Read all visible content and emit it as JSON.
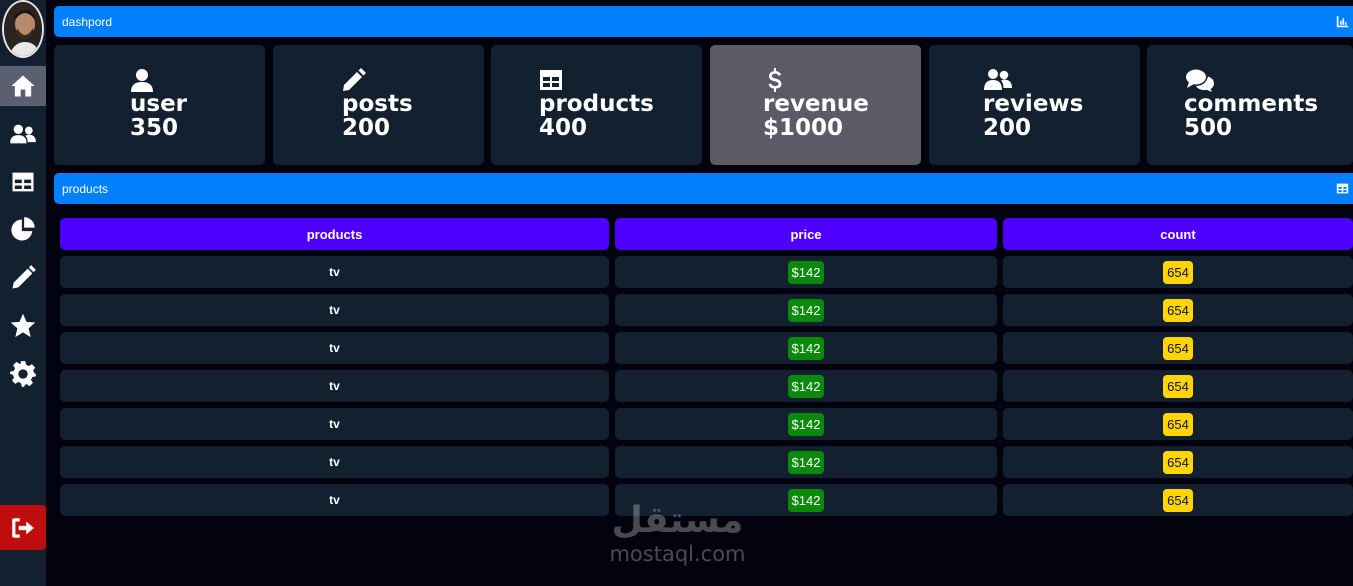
{
  "sidebar": {
    "items": [
      {
        "icon": "home-icon",
        "active": true
      },
      {
        "icon": "users-icon",
        "active": false
      },
      {
        "icon": "table-icon",
        "active": false
      },
      {
        "icon": "pie-chart-icon",
        "active": false
      },
      {
        "icon": "pencil-icon",
        "active": false
      },
      {
        "icon": "star-icon",
        "active": false
      },
      {
        "icon": "gear-icon",
        "active": false
      }
    ],
    "logout_icon": "sign-out-icon"
  },
  "header": {
    "title": "dashpord",
    "icon": "chart-bar-icon"
  },
  "cards": [
    {
      "icon": "user-icon",
      "label": "user",
      "value": "350"
    },
    {
      "icon": "pencil-icon",
      "label": "posts",
      "value": "200"
    },
    {
      "icon": "table-icon",
      "label": "products",
      "value": "400"
    },
    {
      "icon": "dollar-icon",
      "label": "revenue",
      "value": "$1000"
    },
    {
      "icon": "users-icon",
      "label": "reviews",
      "value": "200"
    },
    {
      "icon": "comments-icon",
      "label": "comments",
      "value": "500"
    }
  ],
  "products_section": {
    "title": "products",
    "icon": "table-icon"
  },
  "table": {
    "headers": [
      "products",
      "price",
      "count"
    ],
    "rows": [
      {
        "product": "tv",
        "price": "$142",
        "count": "654"
      },
      {
        "product": "tv",
        "price": "$142",
        "count": "654"
      },
      {
        "product": "tv",
        "price": "$142",
        "count": "654"
      },
      {
        "product": "tv",
        "price": "$142",
        "count": "654"
      },
      {
        "product": "tv",
        "price": "$142",
        "count": "654"
      },
      {
        "product": "tv",
        "price": "$142",
        "count": "654"
      },
      {
        "product": "tv",
        "price": "$142",
        "count": "654"
      }
    ]
  },
  "watermark": {
    "arabic": "مستقل",
    "latin": "mostaql.com"
  },
  "colors": {
    "background": "#02030f",
    "panel": "#132030",
    "accent_blue": "#0080ff",
    "header_purple": "#4d00ff",
    "price_green": "#0a8a0a",
    "count_yellow": "#ffd500",
    "logout_red": "#c00d0d",
    "highlight_card": "#5b5a66"
  }
}
